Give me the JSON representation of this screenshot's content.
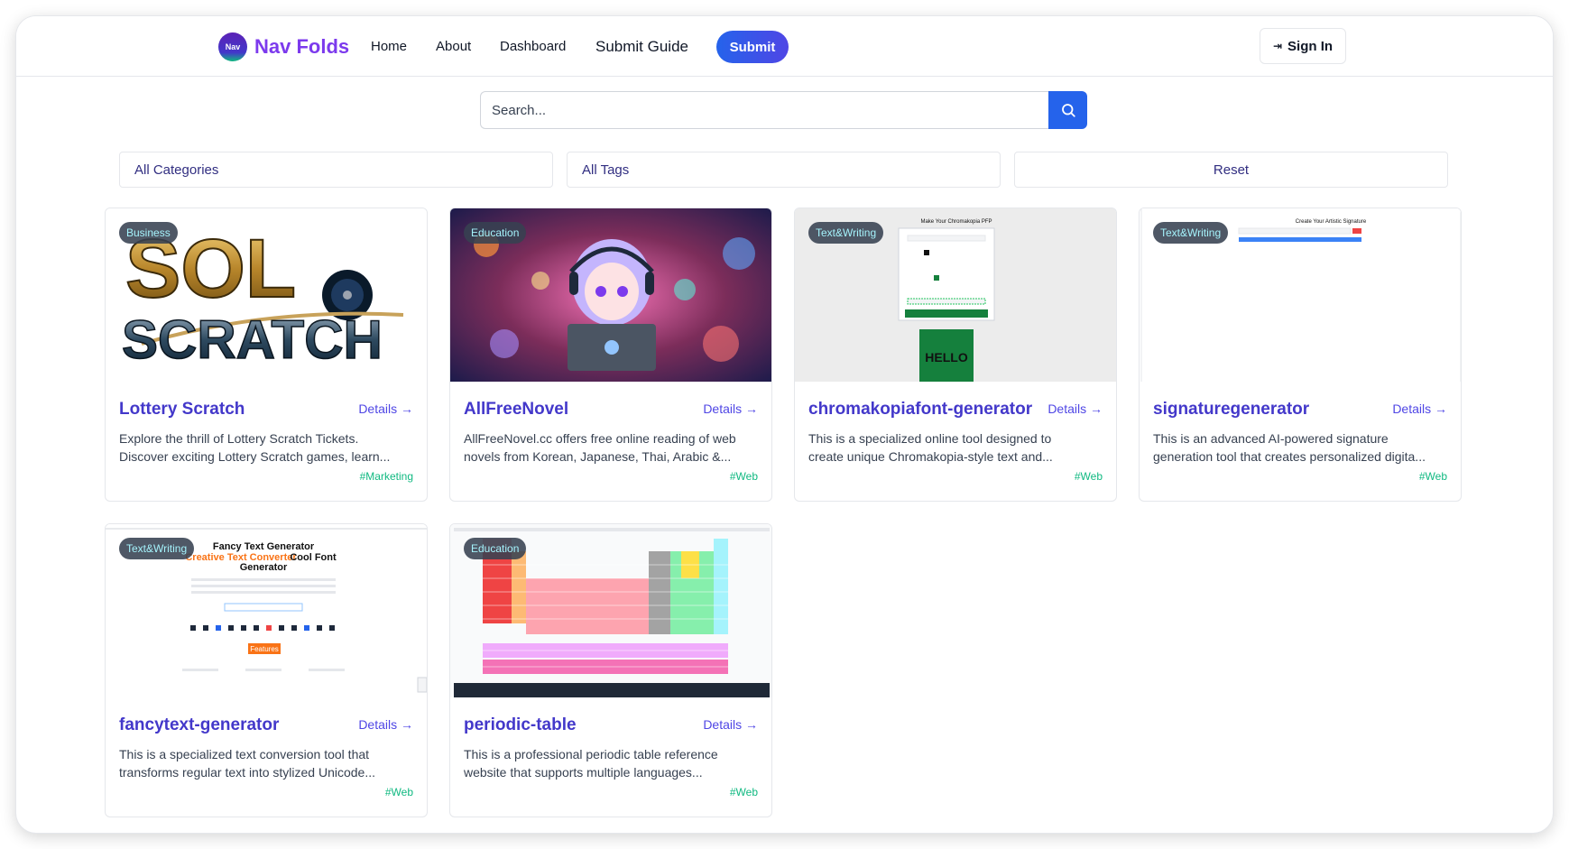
{
  "header": {
    "logo_text": "Nav",
    "brand": "Nav Folds",
    "nav": [
      "Home",
      "About",
      "Dashboard",
      "Submit Guide"
    ],
    "submit_label": "Submit",
    "signin_label": "Sign In"
  },
  "search": {
    "placeholder": "Search..."
  },
  "filters": {
    "categories": "All Categories",
    "tags": "All Tags",
    "reset": "Reset"
  },
  "cards": [
    {
      "category": "Business",
      "title": "Lottery Scratch",
      "details": "Details →",
      "desc1": "Explore the thrill of Lottery Scratch Tickets.",
      "desc2": "Discover exciting Lottery Scratch games, learn...",
      "tag": "#Marketing",
      "thumb_text_1": "SOL",
      "thumb_text_2": "SCRATCH"
    },
    {
      "category": "Education",
      "title": "AllFreeNovel",
      "details": "Details →",
      "desc1": "AllFreeNovel.cc offers free online reading of web",
      "desc2": "novels from Korean, Japanese, Thai, Arabic &...",
      "tag": "#Web"
    },
    {
      "category": "Text&Writing",
      "title": "chromakopiafont-generator",
      "details": "Details →",
      "desc1": "This is a specialized online tool designed to",
      "desc2": "create unique Chromakopia-style text and...",
      "tag": "#Web",
      "thumb_text_1": "Make Your Chromakopia PFP",
      "thumb_text_2": "HELLO"
    },
    {
      "category": "Text&Writing",
      "title": "signaturegenerator",
      "details": "Details →",
      "desc1": "This is an advanced AI-powered signature",
      "desc2": "generation tool that creates personalized digita...",
      "tag": "#Web",
      "thumb_text_1": "Create Your Artistic Signature"
    },
    {
      "category": "Text&Writing",
      "title": "fancytext-generator",
      "details": "Details →",
      "desc1": "This is a specialized text conversion tool that",
      "desc2": "transforms regular text into stylized Unicode...",
      "tag": "#Web",
      "thumb_text_1": "Fancy Text Generator",
      "thumb_text_2": "Creative Text Converter",
      "thumb_text_3": "Cool Font",
      "thumb_text_4": "Generator",
      "thumb_text_5": "Features"
    },
    {
      "category": "Education",
      "title": "periodic-table",
      "details": "Details →",
      "desc1": "This is a professional periodic table reference",
      "desc2": "website that supports multiple languages...",
      "tag": "#Web"
    }
  ],
  "colors": {
    "primary": "#2563eb",
    "brand": "#7c3aed",
    "title": "#4338ca",
    "tag": "#10b981"
  }
}
